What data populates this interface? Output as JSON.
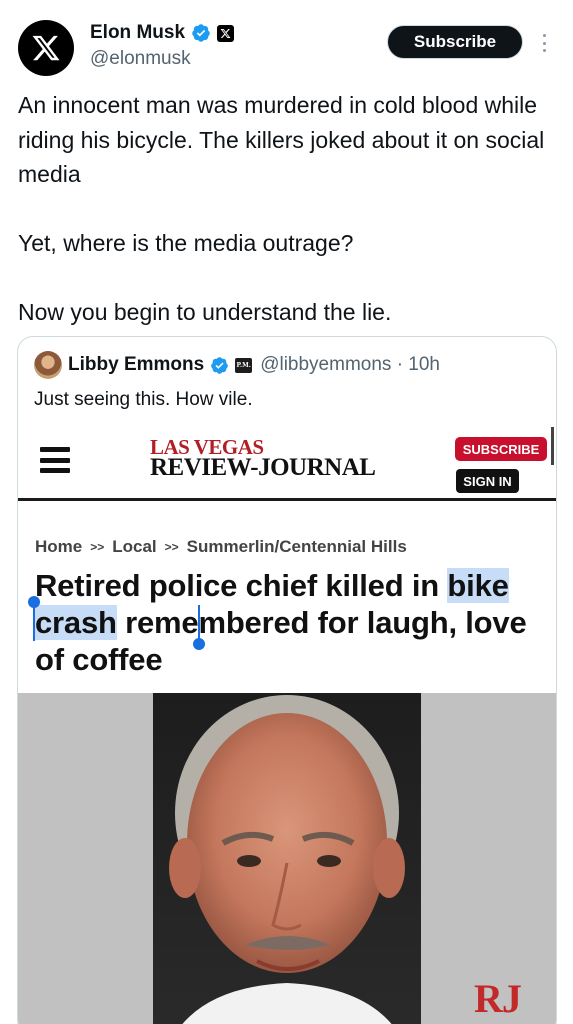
{
  "post": {
    "author_name": "Elon Musk",
    "author_handle": "@elonmusk",
    "subscribe_label": "Subscribe",
    "text_paragraphs": [
      "An innocent man was murdered in cold blood while riding his bicycle. The killers joked about it on social media",
      "Yet, where is the media outrage?",
      "Now you begin to understand the lie."
    ],
    "icons": [
      "x-logo-avatar",
      "verified-badge-icon",
      "x-affiliate-badge-icon",
      "more-options-icon"
    ]
  },
  "quote": {
    "author_name": "Libby Emmons",
    "author_handle": "@libbyemmons",
    "separator": "·",
    "time": "10h",
    "text": "Just seeing this. How vile.",
    "affiliate_badge_text": "P.M."
  },
  "article": {
    "logo_top": "LAS VEGAS",
    "logo_bottom": "REVIEW-JOURNAL",
    "subscribe_label": "SUBSCRIBE",
    "signin_label": "SIGN IN",
    "breadcrumb": [
      "Home",
      "Local",
      "Summerlin/Centennial Hills"
    ],
    "breadcrumb_separator": ">>",
    "headline_parts": [
      "Retired police chief killed in",
      "bike crash",
      " remembered for laugh, love of coffee"
    ],
    "watermark": "RJ"
  },
  "colors": {
    "verified_blue": "#1d9bf0",
    "rj_red": "#c8102e",
    "selection": "#c7dcf7"
  }
}
